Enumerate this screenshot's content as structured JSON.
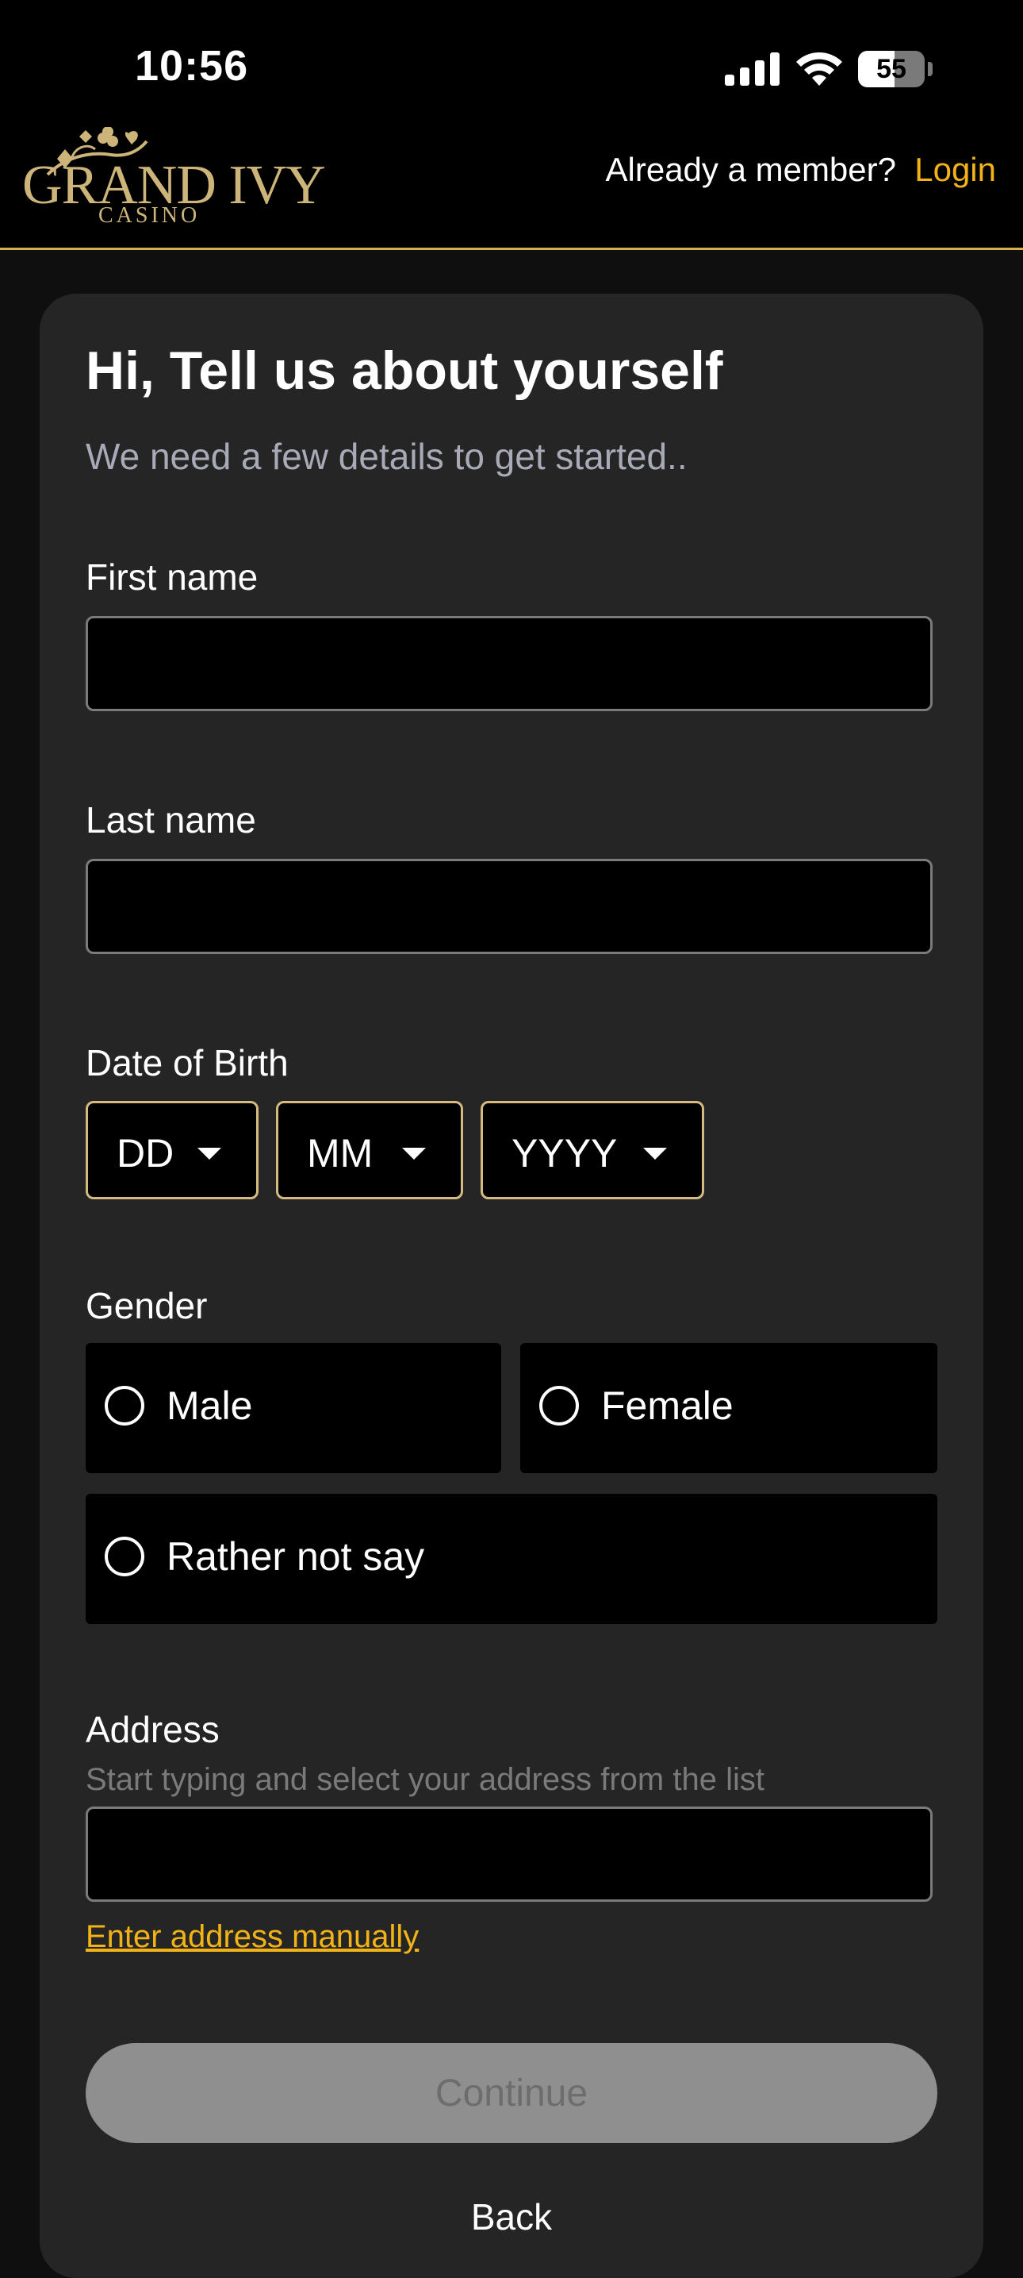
{
  "status_bar": {
    "time": "10:56",
    "battery_level": "55",
    "icons": [
      "signal-icon",
      "wifi-icon",
      "battery-icon"
    ]
  },
  "header": {
    "logo_text": "GRAND IVY",
    "logo_subtext": "CASINO",
    "member_prompt": "Already a member?",
    "login_label": "Login"
  },
  "form": {
    "title": "Hi, Tell us about yourself",
    "subtitle": "We need a few details to get started..",
    "first_name": {
      "label": "First name",
      "value": ""
    },
    "last_name": {
      "label": "Last name",
      "value": ""
    },
    "dob": {
      "label": "Date of Birth",
      "day": "DD",
      "month": "MM",
      "year": "YYYY"
    },
    "gender": {
      "label": "Gender",
      "options": [
        "Male",
        "Female",
        "Rather not say"
      ]
    },
    "address": {
      "label": "Address",
      "hint": "Start typing and select your address from the list",
      "value": "",
      "manual_link": "Enter address manually"
    },
    "continue_label": "Continue",
    "back_label": "Back"
  },
  "colors": {
    "accent": "#f2b316",
    "logo_gold": "#cdb57a",
    "select_border": "#d5bb80",
    "card_bg": "#252525",
    "page_bg": "#0f0f0f"
  }
}
